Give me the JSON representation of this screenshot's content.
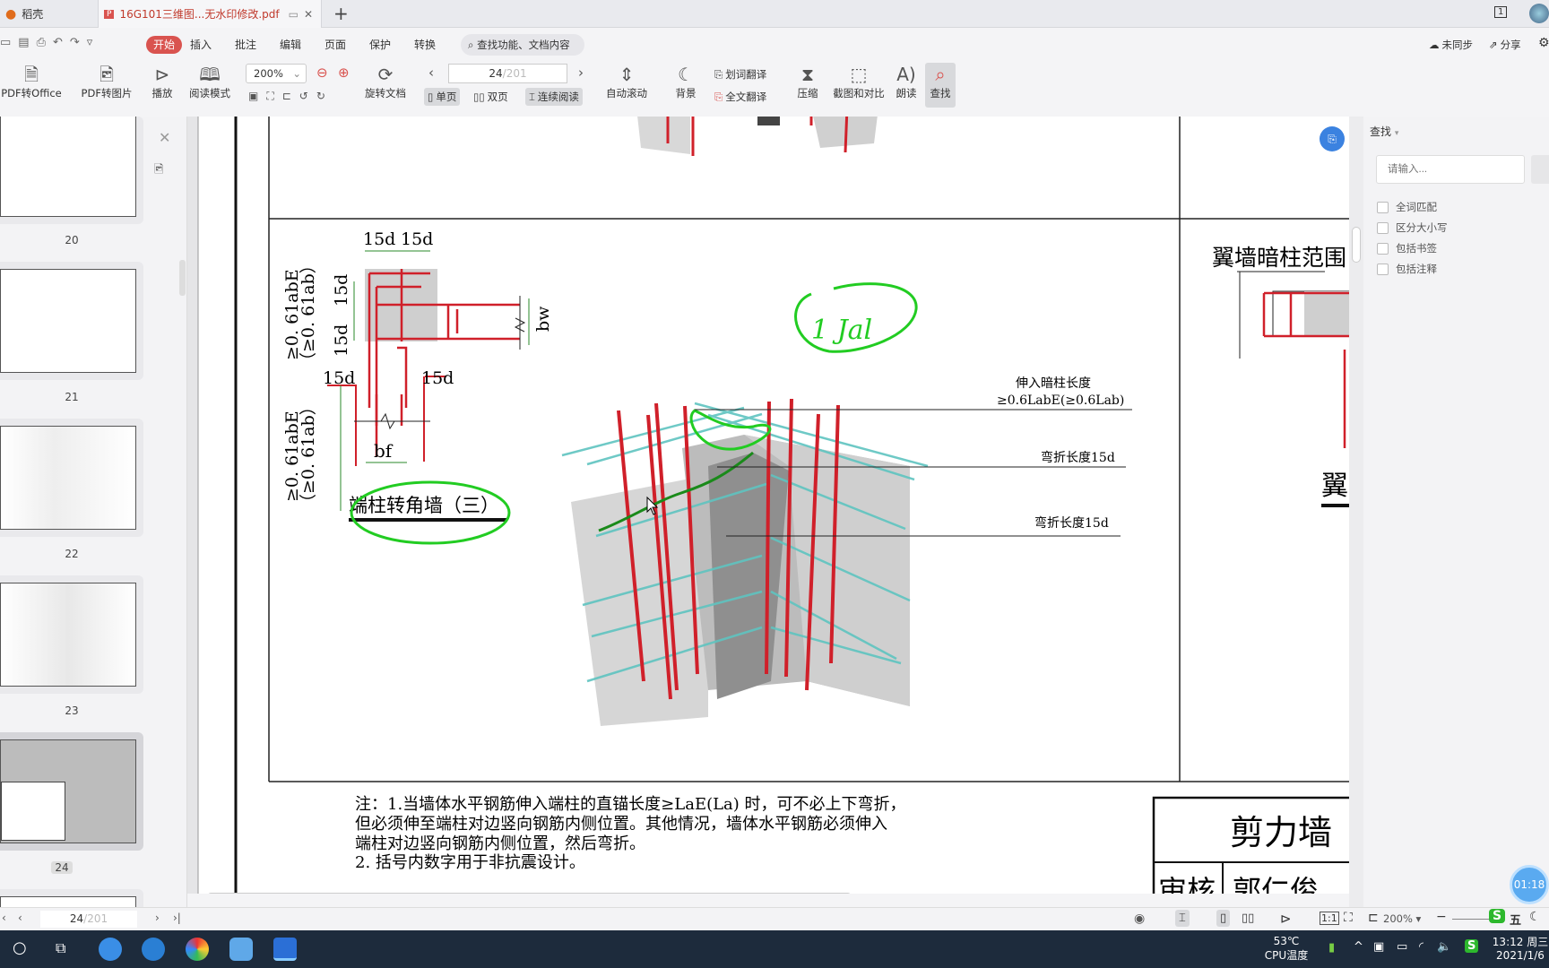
{
  "tabs": [
    {
      "label": "稻壳"
    },
    {
      "label": "16G101三维图...无水印修改.pdf"
    }
  ],
  "new_tab": "+",
  "menu": [
    "开始",
    "插入",
    "批注",
    "编辑",
    "页面",
    "保护",
    "转换"
  ],
  "search_placeholder": "查找功能、文档内容",
  "sync": "未同步",
  "share": "分享",
  "window_count": "1",
  "toolbar": {
    "pdf_to_office": "PDF转Office",
    "pdf_to_image": "PDF转图片",
    "play": "播放",
    "read_mode": "阅读模式",
    "zoom": "200%",
    "rotate": "旋转文档",
    "page_current": "24",
    "page_total": "/201",
    "single": "单页",
    "double": "双页",
    "continuous": "连续阅读",
    "auto_scroll": "自动滚动",
    "background": "背景",
    "word_translate": "划词翻译",
    "full_translate": "全文翻译",
    "compress": "压缩",
    "screenshot_compare": "截图和对比",
    "read_aloud": "朗读",
    "find": "查找"
  },
  "thumbnails": [
    "20",
    "21",
    "22",
    "23",
    "24"
  ],
  "left_nav": {
    "page": "24",
    "total": "/201"
  },
  "drawing": {
    "dim_15d": "15d",
    "dim_bw": "bw",
    "dim_bf": "bf",
    "dim_left1": "≥0. 61abE",
    "dim_left1b": "（≥0. 61ab）",
    "title": "端柱转角墙（三）",
    "label1a": "伸入暗柱长度",
    "label1b": "≥0.6LabE(≥0.6Lab)",
    "label2": "弯折长度15d",
    "label3": "弯折长度15d",
    "right_title": "翼墙暗柱范围",
    "right_char": "翼",
    "notes": [
      "注：1.当墙体水平钢筋伸入端柱的直锚长度≥LaE(La) 时，可不必上下弯折，",
      "但必须伸至端柱对边竖向钢筋内侧位置。其他情况，墙体水平钢筋必须伸入",
      "端柱对边竖向钢筋内侧位置，然后弯折。",
      "2. 括号内数字用于非抗震设计。"
    ],
    "titleblock": "剪力墙",
    "review": "审核",
    "reviewer": "郭仁俊",
    "handwriting": "1 Jal"
  },
  "find_panel": {
    "title": "查找",
    "placeholder": "请输入...",
    "options": [
      "全词匹配",
      "区分大小写",
      "包括书签",
      "包括注释"
    ]
  },
  "status": {
    "zoom": "200%",
    "ime": "五",
    "timer": "01:18"
  },
  "taskbar": {
    "temp": "53℃",
    "temp_label": "CPU温度",
    "time": "13:12 周三",
    "date": "2021/1/6"
  },
  "colors": {
    "accent": "#d9534f",
    "rebar_red": "#d0202a",
    "rebar_teal": "#5fc4c0",
    "annotation_green": "#22cc22"
  }
}
